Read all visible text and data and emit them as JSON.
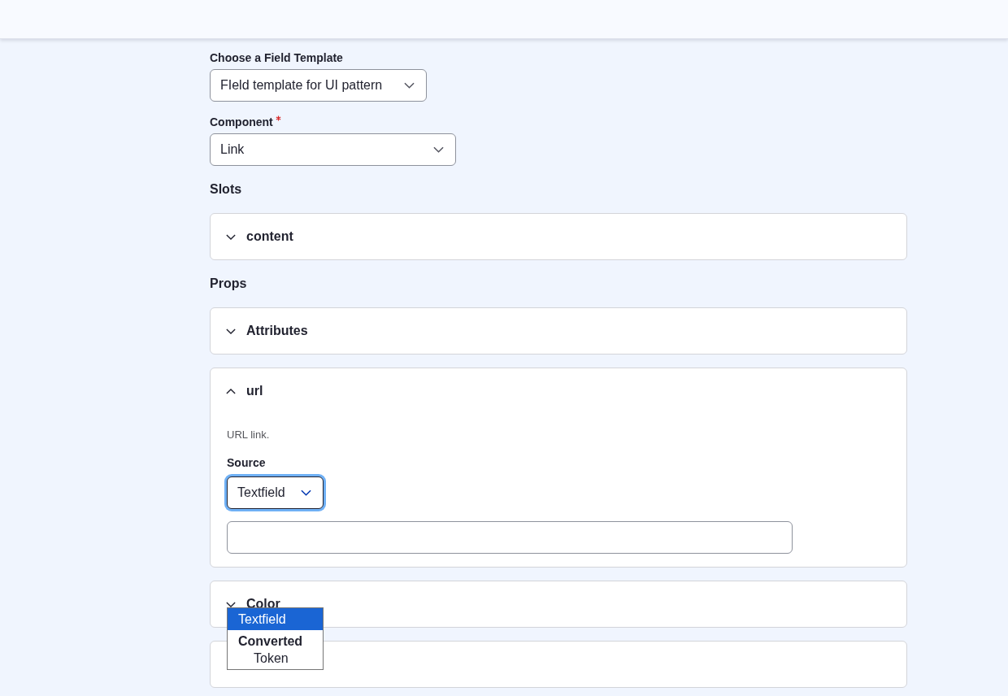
{
  "template_field": {
    "label": "Choose a Field Template",
    "value": "FIeld template for UI pattern"
  },
  "component_field": {
    "label": "Component",
    "required": true,
    "value": "Link"
  },
  "sections": [
    {
      "heading": "Slots",
      "panels": [
        {
          "kind": "accordion",
          "title": "content",
          "expanded": false
        }
      ]
    },
    {
      "heading": "Props",
      "panels": [
        {
          "kind": "accordion",
          "title": "Attributes",
          "expanded": false
        },
        {
          "kind": "accordion",
          "title": "url",
          "expanded": true,
          "description": "URL link.",
          "source": {
            "label": "Source",
            "value": "Textfield",
            "focused": true,
            "open": true,
            "options": [
              {
                "label": "Textfield",
                "selected": true
              }
            ],
            "groups": [
              {
                "label": "Converted",
                "options": [
                  {
                    "label": "Token",
                    "selected": false
                  }
                ]
              }
            ]
          }
        },
        {
          "kind": "accordion",
          "title": "Color",
          "expanded": false
        },
        {
          "kind": "accordion"
        }
      ]
    }
  ]
}
